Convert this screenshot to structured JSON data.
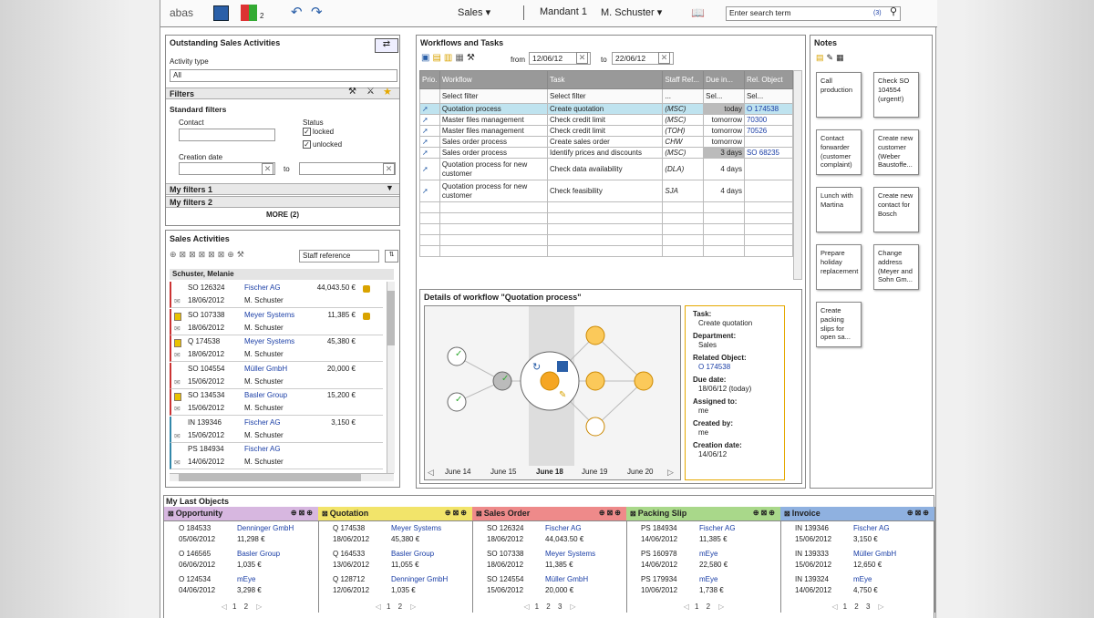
{
  "topbar": {
    "logo": "abas",
    "badge": "2",
    "module": "Sales ▾",
    "mandant": "Mandant 1",
    "user": "M. Schuster ▾",
    "search_placeholder": "Enter search term",
    "search_count": "(3)"
  },
  "osa": {
    "title": "Outstanding Sales Activities",
    "activity_type_label": "Activity type",
    "activity_type_value": "All",
    "filters_label": "Filters",
    "standard_filters": "Standard filters",
    "contact_label": "Contact",
    "status_label": "Status",
    "status_locked": "locked",
    "status_unlocked": "unlocked",
    "creation_date_label": "Creation date",
    "to_label": "to",
    "my_filters_1": "My filters 1",
    "my_filters_2": "My filters 2",
    "more": "MORE (2)"
  },
  "sa": {
    "title": "Sales Activities",
    "staff_ref": "Staff reference",
    "group": "Schuster, Melanie",
    "rows": [
      {
        "id": "SO 126324",
        "date": "18/06/2012",
        "company": "Fischer AG",
        "person": "M. Schuster",
        "amount": "44,043.50 €"
      },
      {
        "id": "SO 107338",
        "date": "18/06/2012",
        "company": "Meyer Systems",
        "person": "M. Schuster",
        "amount": "11,385 €"
      },
      {
        "id": "Q 174538",
        "date": "18/06/2012",
        "company": "Meyer Systems",
        "person": "M. Schuster",
        "amount": "45,380 €"
      },
      {
        "id": "SO 104554",
        "date": "15/06/2012",
        "company": "Müller GmbH",
        "person": "M. Schuster",
        "amount": "20,000 €"
      },
      {
        "id": "SO 134534",
        "date": "15/06/2012",
        "company": "Basler Group",
        "person": "M. Schuster",
        "amount": "15,200 €"
      },
      {
        "id": "IN 139346",
        "date": "15/06/2012",
        "company": "Fischer AG",
        "person": "M. Schuster",
        "amount": "3,150 €"
      },
      {
        "id": "PS 184934",
        "date": "14/06/2012",
        "company": "Fischer AG",
        "person": "M. Schuster",
        "amount": ""
      }
    ]
  },
  "wf": {
    "title": "Workflows and Tasks",
    "from_label": "from",
    "from_date": "12/06/12",
    "to_label": "to",
    "to_date": "22/06/12",
    "headers": [
      "Prio.",
      "Workflow",
      "Task",
      "Staff Ref...",
      "Due in...",
      "Rel. Object"
    ],
    "filters": [
      "",
      "Select filter",
      "Select filter",
      "...",
      "Sel...",
      "Sel..."
    ],
    "rows": [
      {
        "wf": "Quotation process",
        "task": "Create quotation",
        "staff": "(MSC)",
        "due": "today",
        "obj": "O 174538"
      },
      {
        "wf": "Master files management",
        "task": "Check credit limit",
        "staff": "(MSC)",
        "due": "tomorrow",
        "obj": "70300"
      },
      {
        "wf": "Master files management",
        "task": "Check credit limit",
        "staff": "(TOH)",
        "due": "tomorrow",
        "obj": "70526"
      },
      {
        "wf": "Sales order process",
        "task": "Create sales order",
        "staff": "CHW",
        "due": "tomorrow",
        "obj": ""
      },
      {
        "wf": "Sales order process",
        "task": "Identify prices and discounts",
        "staff": "(MSC)",
        "due": "3 days",
        "obj": "SO 68235"
      },
      {
        "wf": "Quotation process for new customer",
        "task": "Check data availability",
        "staff": "(DLA)",
        "due": "4 days",
        "obj": ""
      },
      {
        "wf": "Quotation process for new customer",
        "task": "Check feasibility",
        "staff": "SJA",
        "due": "4 days",
        "obj": ""
      }
    ]
  },
  "details": {
    "title": "Details of workflow \"Quotation process\"",
    "dates": [
      "June 14",
      "June 15",
      "June 18",
      "June 19",
      "June 20"
    ],
    "task_label": "Task:",
    "task": "Create quotation",
    "dept_label": "Department:",
    "dept": "Sales",
    "rel_label": "Related Object:",
    "rel": "O 174538",
    "due_label": "Due date:",
    "due": "18/06/12 (today)",
    "assigned_label": "Assigned to:",
    "assigned": "me",
    "created_by_label": "Created by:",
    "created_by": "me",
    "creation_label": "Creation date:",
    "creation": "14/06/12"
  },
  "notes": {
    "title": "Notes",
    "items": [
      "Call production",
      "Check SO 104554 (urgent!)",
      "Contact forwarder (customer complaint)",
      "Create new customer (Weber Baustoffe...",
      "Lunch with Martina",
      "Create new contact for Bosch",
      "Prepare holiday replacement",
      "Change address (Meyer and Sohn Gm...",
      "Create packing slips for open sa..."
    ]
  },
  "last": {
    "title": "My Last Objects",
    "cols": [
      {
        "name": "Opportunity",
        "color": "#d7b7e0",
        "rows": [
          [
            "O 184533",
            "05/06/2012",
            "Denninger GmbH",
            "11,298 €"
          ],
          [
            "O 146565",
            "06/06/2012",
            "Basler Group",
            "1,035 €"
          ],
          [
            "O 124534",
            "04/06/2012",
            "mEye",
            "3,298 €"
          ]
        ],
        "pages": "1 2"
      },
      {
        "name": "Quotation",
        "color": "#f2e46a",
        "rows": [
          [
            "Q 174538",
            "18/06/2012",
            "Meyer Systems",
            "45,380 €"
          ],
          [
            "Q 164533",
            "13/06/2012",
            "Basler Group",
            "11,055 €"
          ],
          [
            "Q 128712",
            "12/06/2012",
            "Denninger GmbH",
            "1,035 €"
          ]
        ],
        "pages": "1 2"
      },
      {
        "name": "Sales Order",
        "color": "#ee8a8a",
        "rows": [
          [
            "SO 126324",
            "18/06/2012",
            "Fischer AG",
            "44,043.50 €"
          ],
          [
            "SO 107338",
            "18/06/2012",
            "Meyer Systems",
            "11,385 €"
          ],
          [
            "SO 124554",
            "15/06/2012",
            "Müller GmbH",
            "20,000 €"
          ]
        ],
        "pages": "1 2 3"
      },
      {
        "name": "Packing Slip",
        "color": "#a9d88a",
        "rows": [
          [
            "PS 184934",
            "14/06/2012",
            "Fischer AG",
            "11,385 €"
          ],
          [
            "PS 160978",
            "14/06/2012",
            "mEye",
            "22,580 €"
          ],
          [
            "PS 179934",
            "10/06/2012",
            "mEye",
            "1,738 €"
          ]
        ],
        "pages": "1 2"
      },
      {
        "name": "Invoice",
        "color": "#8fb1e0",
        "rows": [
          [
            "IN 139346",
            "15/06/2012",
            "Fischer AG",
            "3,150 €"
          ],
          [
            "IN 139333",
            "15/06/2012",
            "Müller GmbH",
            "12,650 €"
          ],
          [
            "IN 139324",
            "14/06/2012",
            "mEye",
            "4,750 €"
          ]
        ],
        "pages": "1 2 3"
      }
    ]
  }
}
